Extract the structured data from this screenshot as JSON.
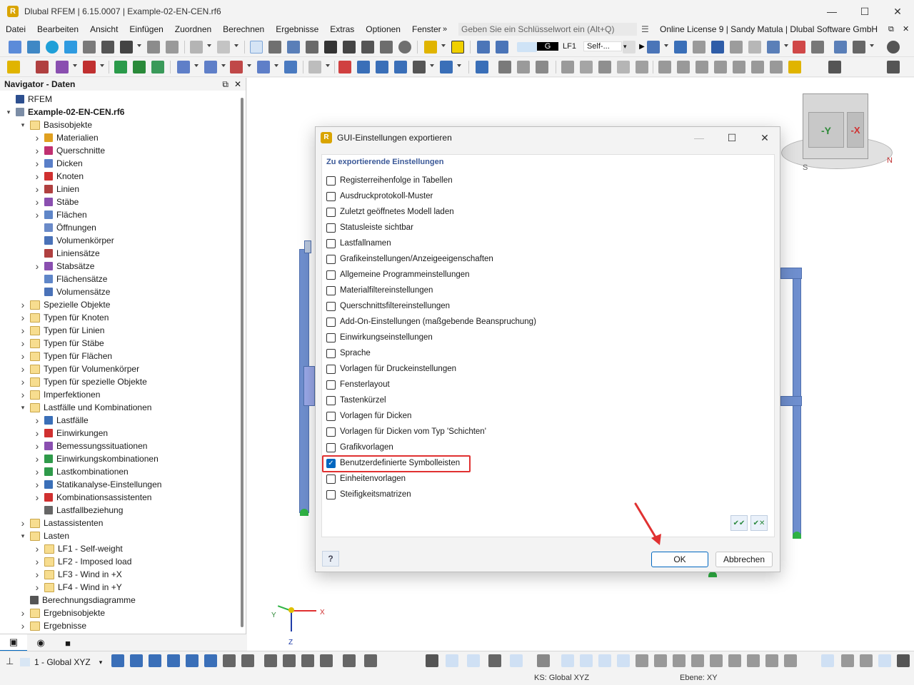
{
  "window": {
    "title": "Dlubal RFEM | 6.15.0007 | Example-02-EN-CEN.rf6",
    "minimize": "—",
    "maximize": "☐",
    "close": "✕"
  },
  "menu": {
    "items": [
      "Datei",
      "Bearbeiten",
      "Ansicht",
      "Einfügen",
      "Zuordnen",
      "Berechnen",
      "Ergebnisse",
      "Extras",
      "Optionen",
      "Fenster"
    ],
    "more": "»",
    "search_placeholder": "Geben Sie ein Schlüsselwort ein (Alt+Q)",
    "license": "Online License 9 | Sandy Matula | Dlubal Software GmbH"
  },
  "loadcase": {
    "group": "G",
    "id": "LF1",
    "name": "Self-..."
  },
  "navigator": {
    "title": "Navigator - Daten",
    "pin": "⧉",
    "close": "✕",
    "tree": [
      {
        "label": "RFEM",
        "level": 0,
        "arrow": "",
        "icon": "rfem-icon",
        "bold": false
      },
      {
        "label": "Example-02-EN-CEN.rf6",
        "level": 0,
        "arrow": "v",
        "icon": "model-file-icon",
        "bold": true
      },
      {
        "label": "Basisobjekte",
        "level": 1,
        "arrow": "v",
        "icon": "folder-icon",
        "bold": false
      },
      {
        "label": "Materialien",
        "level": 2,
        "arrow": ">",
        "icon": "materials-icon",
        "bold": false
      },
      {
        "label": "Querschnitte",
        "level": 2,
        "arrow": ">",
        "icon": "sections-icon",
        "bold": false
      },
      {
        "label": "Dicken",
        "level": 2,
        "arrow": ">",
        "icon": "thickness-icon",
        "bold": false
      },
      {
        "label": "Knoten",
        "level": 2,
        "arrow": ">",
        "icon": "node-icon",
        "bold": false
      },
      {
        "label": "Linien",
        "level": 2,
        "arrow": ">",
        "icon": "line-icon",
        "bold": false
      },
      {
        "label": "Stäbe",
        "level": 2,
        "arrow": ">",
        "icon": "member-icon",
        "bold": false
      },
      {
        "label": "Flächen",
        "level": 2,
        "arrow": ">",
        "icon": "surface-icon",
        "bold": false
      },
      {
        "label": "Öffnungen",
        "level": 2,
        "arrow": "",
        "icon": "opening-icon",
        "bold": false
      },
      {
        "label": "Volumenkörper",
        "level": 2,
        "arrow": "",
        "icon": "solid-icon",
        "bold": false
      },
      {
        "label": "Liniensätze",
        "level": 2,
        "arrow": "",
        "icon": "lineset-icon",
        "bold": false
      },
      {
        "label": "Stabsätze",
        "level": 2,
        "arrow": ">",
        "icon": "memberset-icon",
        "bold": false
      },
      {
        "label": "Flächensätze",
        "level": 2,
        "arrow": "",
        "icon": "surfaceset-icon",
        "bold": false
      },
      {
        "label": "Volumensätze",
        "level": 2,
        "arrow": "",
        "icon": "solidset-icon",
        "bold": false
      },
      {
        "label": "Spezielle Objekte",
        "level": 1,
        "arrow": ">",
        "icon": "folder-icon",
        "bold": false
      },
      {
        "label": "Typen für Knoten",
        "level": 1,
        "arrow": ">",
        "icon": "folder-icon",
        "bold": false
      },
      {
        "label": "Typen für Linien",
        "level": 1,
        "arrow": ">",
        "icon": "folder-icon",
        "bold": false
      },
      {
        "label": "Typen für Stäbe",
        "level": 1,
        "arrow": ">",
        "icon": "folder-icon",
        "bold": false
      },
      {
        "label": "Typen für Flächen",
        "level": 1,
        "arrow": ">",
        "icon": "folder-icon",
        "bold": false
      },
      {
        "label": "Typen für Volumenkörper",
        "level": 1,
        "arrow": ">",
        "icon": "folder-icon",
        "bold": false
      },
      {
        "label": "Typen für spezielle Objekte",
        "level": 1,
        "arrow": ">",
        "icon": "folder-icon",
        "bold": false
      },
      {
        "label": "Imperfektionen",
        "level": 1,
        "arrow": ">",
        "icon": "folder-icon",
        "bold": false
      },
      {
        "label": "Lastfälle und Kombinationen",
        "level": 1,
        "arrow": "v",
        "icon": "folder-icon",
        "bold": false
      },
      {
        "label": "Lastfälle",
        "level": 2,
        "arrow": ">",
        "icon": "loadcase-icon",
        "bold": false
      },
      {
        "label": "Einwirkungen",
        "level": 2,
        "arrow": ">",
        "icon": "action-icon",
        "bold": false
      },
      {
        "label": "Bemessungssituationen",
        "level": 2,
        "arrow": ">",
        "icon": "design-situation-icon",
        "bold": false
      },
      {
        "label": "Einwirkungskombinationen",
        "level": 2,
        "arrow": ">",
        "icon": "action-combination-icon",
        "bold": false
      },
      {
        "label": "Lastkombinationen",
        "level": 2,
        "arrow": ">",
        "icon": "load-combination-icon",
        "bold": false
      },
      {
        "label": "Statikanalyse-Einstellungen",
        "level": 2,
        "arrow": ">",
        "icon": "analysis-settings-icon",
        "bold": false
      },
      {
        "label": "Kombinationsassistenten",
        "level": 2,
        "arrow": ">",
        "icon": "combination-wizard-icon",
        "bold": false
      },
      {
        "label": "Lastfallbeziehung",
        "level": 2,
        "arrow": "",
        "icon": "relationship-icon",
        "bold": false
      },
      {
        "label": "Lastassistenten",
        "level": 1,
        "arrow": ">",
        "icon": "folder-icon",
        "bold": false
      },
      {
        "label": "Lasten",
        "level": 1,
        "arrow": "v",
        "icon": "folder-icon",
        "bold": false
      },
      {
        "label": "LF1 - Self-weight",
        "level": 2,
        "arrow": ">",
        "icon": "folder-icon",
        "bold": false
      },
      {
        "label": "LF2 - Imposed load",
        "level": 2,
        "arrow": ">",
        "icon": "folder-icon",
        "bold": false
      },
      {
        "label": "LF3 - Wind in +X",
        "level": 2,
        "arrow": ">",
        "icon": "folder-icon",
        "bold": false
      },
      {
        "label": "LF4 - Wind in +Y",
        "level": 2,
        "arrow": ">",
        "icon": "folder-icon",
        "bold": false
      },
      {
        "label": "Berechnungsdiagramme",
        "level": 1,
        "arrow": "",
        "icon": "diagram-icon",
        "bold": false
      },
      {
        "label": "Ergebnisobjekte",
        "level": 1,
        "arrow": ">",
        "icon": "folder-icon",
        "bold": false
      },
      {
        "label": "Ergebnisse",
        "level": 1,
        "arrow": ">",
        "icon": "folder-icon",
        "bold": false
      }
    ]
  },
  "dialog": {
    "title": "GUI-Einstellungen exportieren",
    "section": "Zu exportierende Einstellungen",
    "options": [
      {
        "label": "Registerreihenfolge in Tabellen",
        "checked": false
      },
      {
        "label": "Ausdruckprotokoll-Muster",
        "checked": false
      },
      {
        "label": "Zuletzt geöffnetes Modell laden",
        "checked": false
      },
      {
        "label": "Statusleiste sichtbar",
        "checked": false
      },
      {
        "label": "Lastfallnamen",
        "checked": false
      },
      {
        "label": "Grafikeinstellungen/Anzeigeeigenschaften",
        "checked": false
      },
      {
        "label": "Allgemeine Programmeinstellungen",
        "checked": false
      },
      {
        "label": "Materialfiltereinstellungen",
        "checked": false
      },
      {
        "label": "Querschnittsfiltereinstellungen",
        "checked": false
      },
      {
        "label": "Add-On-Einstellungen (maßgebende Beanspruchung)",
        "checked": false
      },
      {
        "label": "Einwirkungseinstellungen",
        "checked": false
      },
      {
        "label": "Sprache",
        "checked": false
      },
      {
        "label": "Vorlagen für Druckeinstellungen",
        "checked": false
      },
      {
        "label": "Fensterlayout",
        "checked": false
      },
      {
        "label": "Tastenkürzel",
        "checked": false
      },
      {
        "label": "Vorlagen für Dicken",
        "checked": false
      },
      {
        "label": "Vorlagen für Dicken vom Typ 'Schichten'",
        "checked": false
      },
      {
        "label": "Grafikvorlagen",
        "checked": false
      },
      {
        "label": "Benutzerdefinierte Symbolleisten",
        "checked": true
      },
      {
        "label": "Einheitenvorlagen",
        "checked": false
      },
      {
        "label": "Steifigkeitsmatrizen",
        "checked": false
      }
    ],
    "ok_label": "OK",
    "cancel_label": "Abbrechen",
    "help": "?"
  },
  "viewcube": {
    "minus_y": "-Y",
    "minus_x": "-X",
    "south": "S",
    "north": "N"
  },
  "axes": {
    "x": "X",
    "y": "Y",
    "z": "Z"
  },
  "statusbar": {
    "coordinate_system": "1 - Global XYZ",
    "ks": "KS: Global XYZ",
    "ebene": "Ebene: XY"
  },
  "colors": {
    "accent": "#0067c0",
    "highlight": "#e03131",
    "member": "#6f8fcf",
    "support": "#2fb344"
  }
}
